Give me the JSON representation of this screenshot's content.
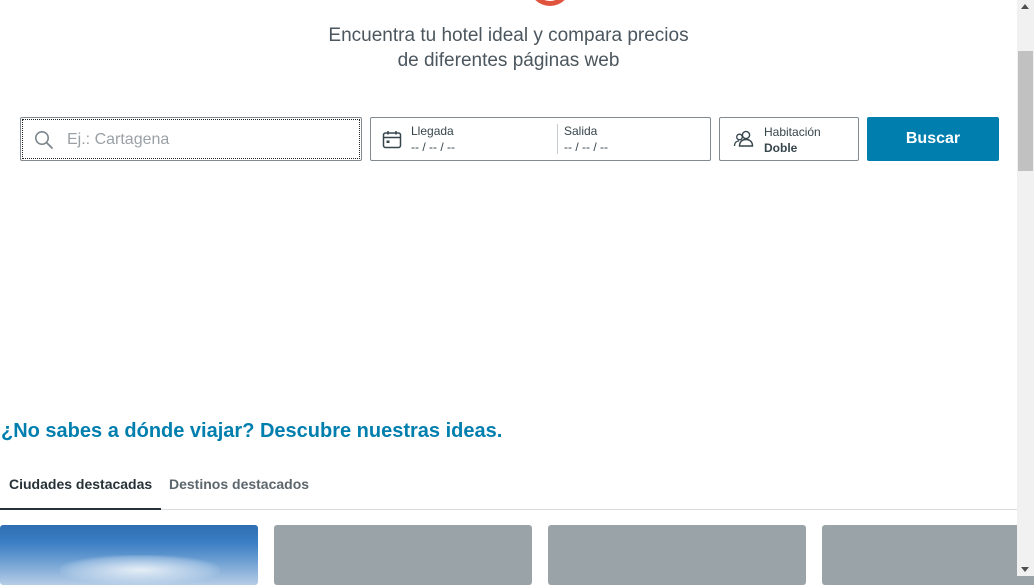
{
  "tagline": {
    "line1": "Encuentra tu hotel ideal y compara precios",
    "line2": "de diferentes páginas web"
  },
  "search": {
    "destination_placeholder": "Ej.: Cartagena",
    "destination_value": "",
    "arrival_label": "Llegada",
    "arrival_value": "-- / -- / --",
    "departure_label": "Salida",
    "departure_value": "-- / -- / --",
    "room_label": "Habitación",
    "room_value": "Doble",
    "button_label": "Buscar"
  },
  "ideas": {
    "title": "¿No sabes a dónde viajar? Descubre nuestras ideas.",
    "tabs": [
      {
        "label": "Ciudades destacadas",
        "active": true
      },
      {
        "label": "Destinos destacados",
        "active": false
      }
    ]
  },
  "colors": {
    "accent": "#007faf",
    "logo": "#e0543d",
    "placeholder_card": "#9aa3a8"
  },
  "icons": {
    "destination": "search-icon",
    "dates": "calendar-icon",
    "room": "guests-icon"
  }
}
